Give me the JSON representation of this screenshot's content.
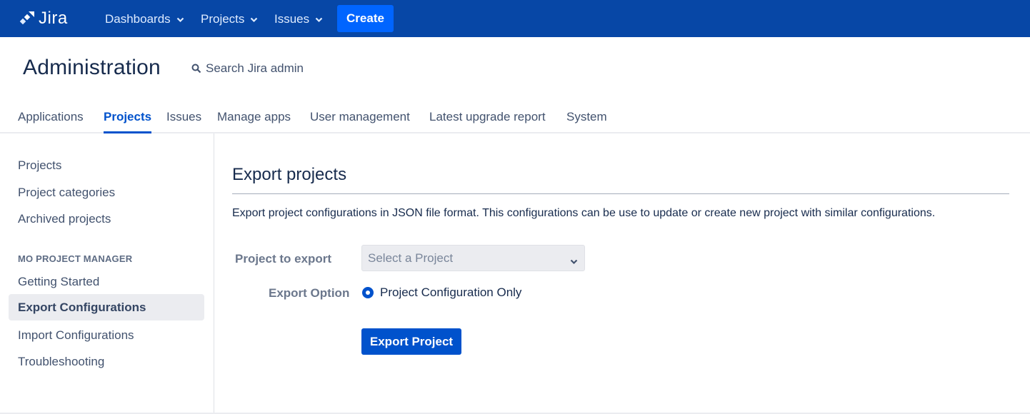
{
  "topbar": {
    "logo_text": "Jira",
    "nav": [
      {
        "label": "Dashboards",
        "icon": "chevron-down-icon"
      },
      {
        "label": "Projects",
        "icon": "chevron-down-icon"
      },
      {
        "label": "Issues",
        "icon": "chevron-down-icon"
      }
    ],
    "create_label": "Create"
  },
  "admin": {
    "title": "Administration",
    "search_label": "Search Jira admin",
    "search_icon": "search-icon"
  },
  "tabs": [
    {
      "label": "Applications",
      "active": false
    },
    {
      "label": "Projects",
      "active": true
    },
    {
      "label": "Issues",
      "active": false
    },
    {
      "label": "Manage apps",
      "active": false
    },
    {
      "label": "User management",
      "active": false
    },
    {
      "label": "Latest upgrade report",
      "active": false
    },
    {
      "label": "System",
      "active": false
    }
  ],
  "sidebar": {
    "items": [
      {
        "label": "Projects"
      },
      {
        "label": "Project categories"
      },
      {
        "label": "Archived projects"
      }
    ],
    "section_heading": "MO PROJECT MANAGER",
    "section_items": [
      {
        "label": "Getting Started",
        "active": false
      },
      {
        "label": "Export Configurations",
        "active": true
      },
      {
        "label": "Import Configurations",
        "active": false
      },
      {
        "label": "Troubleshooting",
        "active": false
      }
    ]
  },
  "main": {
    "heading": "Export projects",
    "description": "Export project configurations in JSON file format. This configurations can be use to update or create new project with similar configurations.",
    "form": {
      "project_label": "Project to export",
      "project_select_value": "Select a Project",
      "export_option_label": "Export Option",
      "export_option_value": "Project Configuration Only",
      "export_option_selected": true,
      "submit_label": "Export Project"
    }
  },
  "colors": {
    "topbar": "#0747a6",
    "create_button": "#0065ff",
    "primary": "#0052cc",
    "active_sidebar_bg": "#ebecf0"
  }
}
